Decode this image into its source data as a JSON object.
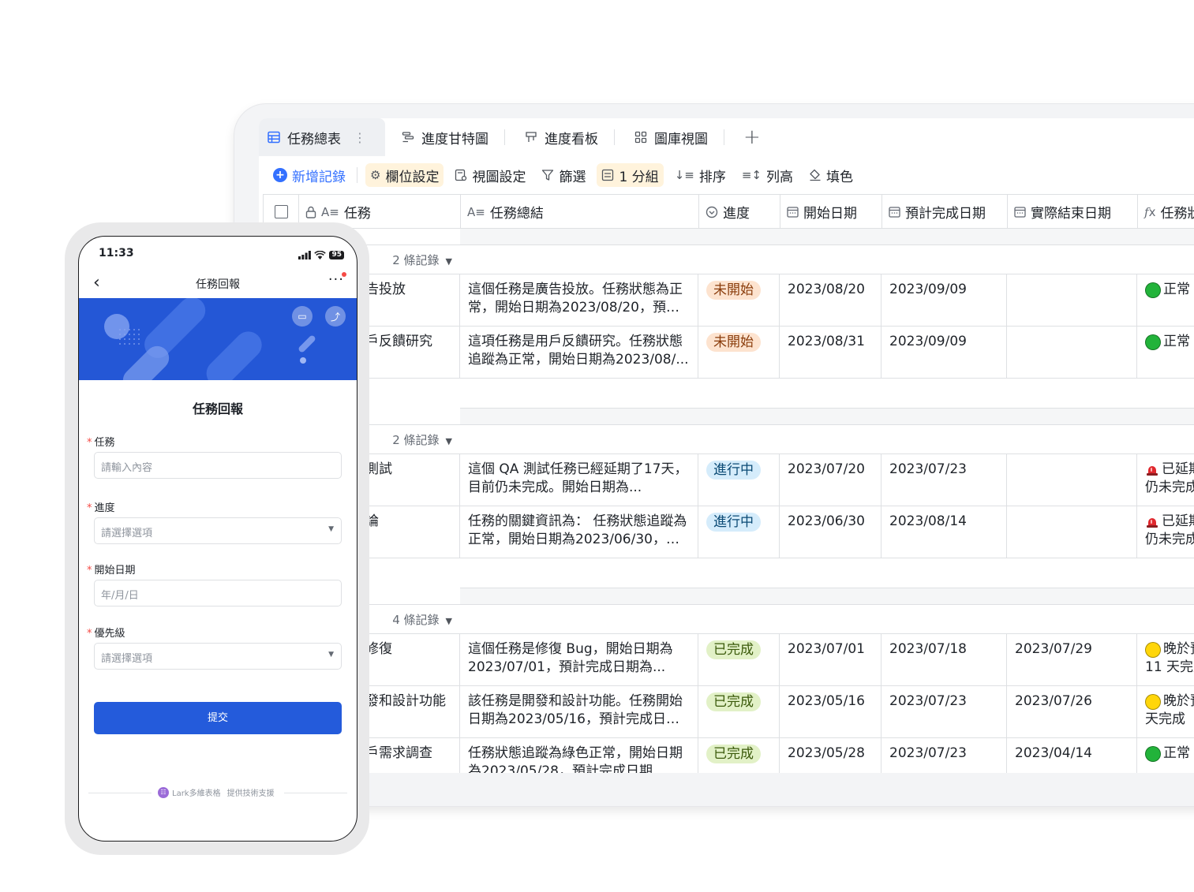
{
  "tabs": [
    {
      "label": "任務總表",
      "icon": "grid-table-icon",
      "active": true
    },
    {
      "label": "進度甘特圖",
      "icon": "gantt-icon"
    },
    {
      "label": "進度看板",
      "icon": "kanban-icon"
    },
    {
      "label": "圖庫視圖",
      "icon": "gallery-icon"
    }
  ],
  "toolbar": {
    "add": "新增記錄",
    "field_settings": "欄位設定",
    "view_settings": "視圖設定",
    "filter": "篩選",
    "group": "1 分組",
    "sort": "排序",
    "row_height": "列高",
    "fill_color": "填色"
  },
  "columns": [
    "任務",
    "任務總結",
    "進度",
    "開始日期",
    "預計完成日期",
    "實際結束日期",
    "任務狀"
  ],
  "groups": [
    {
      "count_label": "2 條記錄",
      "rows": [
        {
          "task": "告投放",
          "summary": "這個任務是廣告投放。任務狀態為正常，開始日期為2023/08/20，預計...",
          "progress": "未開始",
          "start": "2023/08/20",
          "planned": "2023/09/09",
          "actual": "",
          "status_line1": "正常",
          "status_line2": ""
        },
        {
          "task": "戶反饋研究",
          "summary": "這項任務是用戶反饋研究。任務狀態追蹤為正常，開始日期為2023/08/...",
          "progress": "未開始",
          "start": "2023/08/31",
          "planned": "2023/09/09",
          "actual": "",
          "status_line1": "正常",
          "status_line2": ""
        }
      ]
    },
    {
      "count_label": "2 條記錄",
      "rows": [
        {
          "task": "測試",
          "summary": "這個 QA 測試任務已經延期了17天，目前仍未完成。開始日期為...",
          "progress": "進行中",
          "start": "2023/07/20",
          "planned": "2023/07/23",
          "actual": "",
          "status_line1": "已延期",
          "status_line2": "仍未完成"
        },
        {
          "task": "論",
          "summary": "任務的關鍵資訊為： 任務狀態追蹤為正常，開始日期為2023/06/30，預...",
          "progress": "進行中",
          "start": "2023/06/30",
          "planned": "2023/08/14",
          "actual": "",
          "status_line1": "已延期",
          "status_line2": "仍未完成"
        }
      ]
    },
    {
      "count_label": "4 條記錄",
      "rows": [
        {
          "task": "修復",
          "summary": "這個任務是修復 Bug，開始日期為2023/07/01，預計完成日期為...",
          "progress": "已完成",
          "start": "2023/07/01",
          "planned": "2023/07/18",
          "actual": "2023/07/29",
          "status_line1": "晚於預",
          "status_line2": "11 天完成"
        },
        {
          "task": "發和設計功能",
          "summary": "該任務是開發和設計功能。任務開始日期為2023/05/16，預計完成日期...",
          "progress": "已完成",
          "start": "2023/05/16",
          "planned": "2023/07/23",
          "actual": "2023/07/26",
          "status_line1": "晚於預",
          "status_line2": "天完成"
        },
        {
          "task": "戶需求調查",
          "summary": "任務狀態追蹤為綠色正常，開始日期為2023/05/28，預計完成日期...",
          "progress": "已完成",
          "start": "2023/05/28",
          "planned": "2023/07/23",
          "actual": "2023/04/14",
          "status_line1": "正常",
          "status_line2": ""
        }
      ]
    }
  ],
  "progress_colors": {
    "未開始": {
      "bg": "#fde3cf",
      "fg": "#8a3c0b"
    },
    "進行中": {
      "bg": "#d5ecfb",
      "fg": "#0b4a75"
    },
    "已完成": {
      "bg": "#e2f1c7",
      "fg": "#3b5a0b"
    }
  },
  "phone": {
    "time": "11:33",
    "battery": "95",
    "nav_title": "任務回報",
    "form_title": "任務回報",
    "fields": [
      {
        "label": "任務",
        "placeholder": "請輸入內容",
        "type": "text"
      },
      {
        "label": "進度",
        "placeholder": "請選擇選項",
        "type": "select"
      },
      {
        "label": "開始日期",
        "placeholder": "年/月/日",
        "type": "date"
      },
      {
        "label": "優先級",
        "placeholder": "請選擇選項",
        "type": "select"
      }
    ],
    "submit": "提交",
    "footer_brand": "Lark多維表格",
    "footer_support": "提供技術支援"
  },
  "colors": {
    "accent": "#3370ff",
    "banner": "#2457d6",
    "submit": "#245bdb"
  }
}
